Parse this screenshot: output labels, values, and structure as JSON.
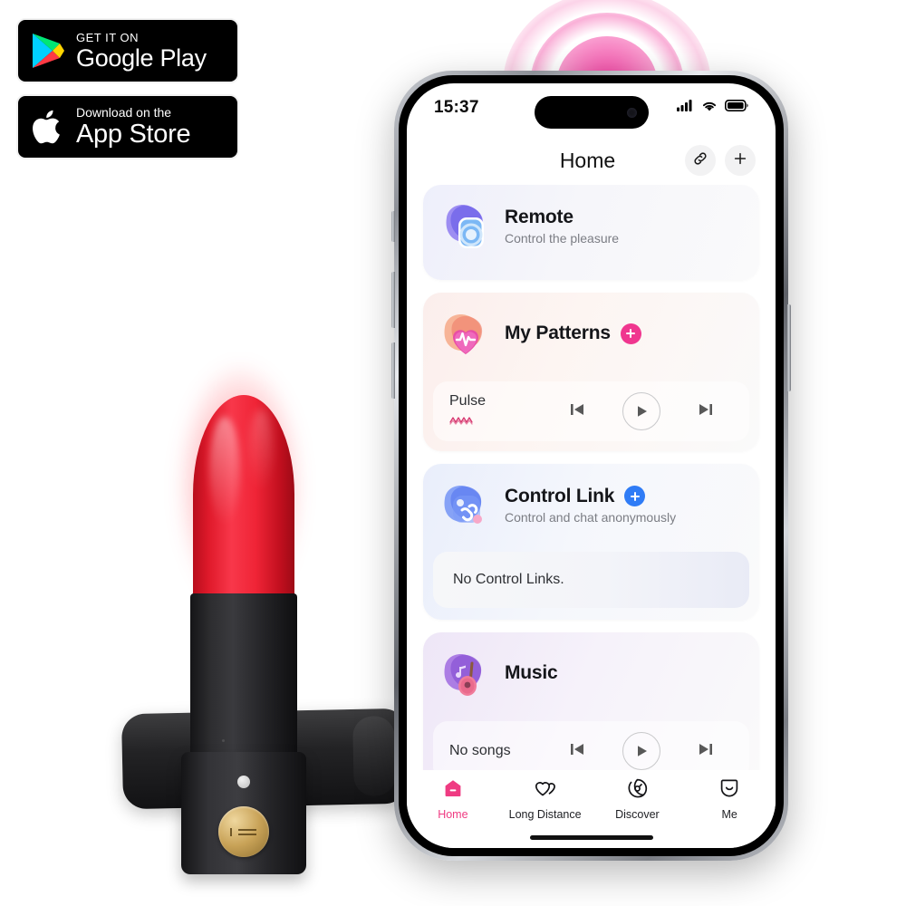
{
  "badges": [
    {
      "small": "GET IT ON",
      "big": "Google Play",
      "icon": "google-play-icon",
      "name": "google-play-badge"
    },
    {
      "small": "Download on the",
      "big": "App Store",
      "icon": "apple-logo-icon",
      "name": "app-store-badge"
    }
  ],
  "phone": {
    "status": {
      "time": "15:37",
      "cellular_icon": "cellular-signal-icon",
      "wifi_icon": "wifi-icon",
      "battery_icon": "battery-icon"
    },
    "header": {
      "title": "Home",
      "link_button": "link-icon",
      "add_button": "plus-icon"
    },
    "cards": [
      {
        "id": "remote",
        "title": "Remote",
        "subtitle": "Control the pleasure",
        "icon": "remote-app-icon"
      },
      {
        "id": "patterns",
        "title": "My Patterns",
        "add_icon": "plus-icon",
        "add_color": "#f0368f",
        "icon": "heart-waveform-icon",
        "pattern_name": "Pulse",
        "pattern_wave_icon": "zigzag-wave-icon",
        "controls": {
          "previous": "previous-track-icon",
          "play": "play-icon",
          "next": "next-track-icon"
        }
      },
      {
        "id": "control-link",
        "title": "Control Link",
        "subtitle": "Control and chat anonymously",
        "add_icon": "plus-icon",
        "add_color": "#2f7cf6",
        "icon": "chain-link-app-icon",
        "empty_text": "No Control Links."
      },
      {
        "id": "music",
        "title": "Music",
        "icon": "guitar-music-icon",
        "empty_text": "No songs",
        "controls": {
          "previous": "previous-track-icon",
          "play": "play-icon",
          "next": "next-track-icon"
        }
      }
    ],
    "tabs": [
      {
        "label": "Home",
        "icon": "home-icon",
        "active": true
      },
      {
        "label": "Long Distance",
        "icon": "two-hearts-icon",
        "active": false
      },
      {
        "label": "Discover",
        "icon": "compass-icon",
        "active": false
      },
      {
        "label": "Me",
        "icon": "profile-droplet-icon",
        "active": false
      }
    ],
    "accent_color": "#ef3b82"
  },
  "product": {
    "name": "lipstick-vibrator",
    "body_color": "#e01a2b",
    "base_color": "#232325",
    "badge_color": "#c8a257"
  },
  "waves": {
    "name": "pink-signal-waves",
    "color": "#f43ca0",
    "rings": 3
  }
}
